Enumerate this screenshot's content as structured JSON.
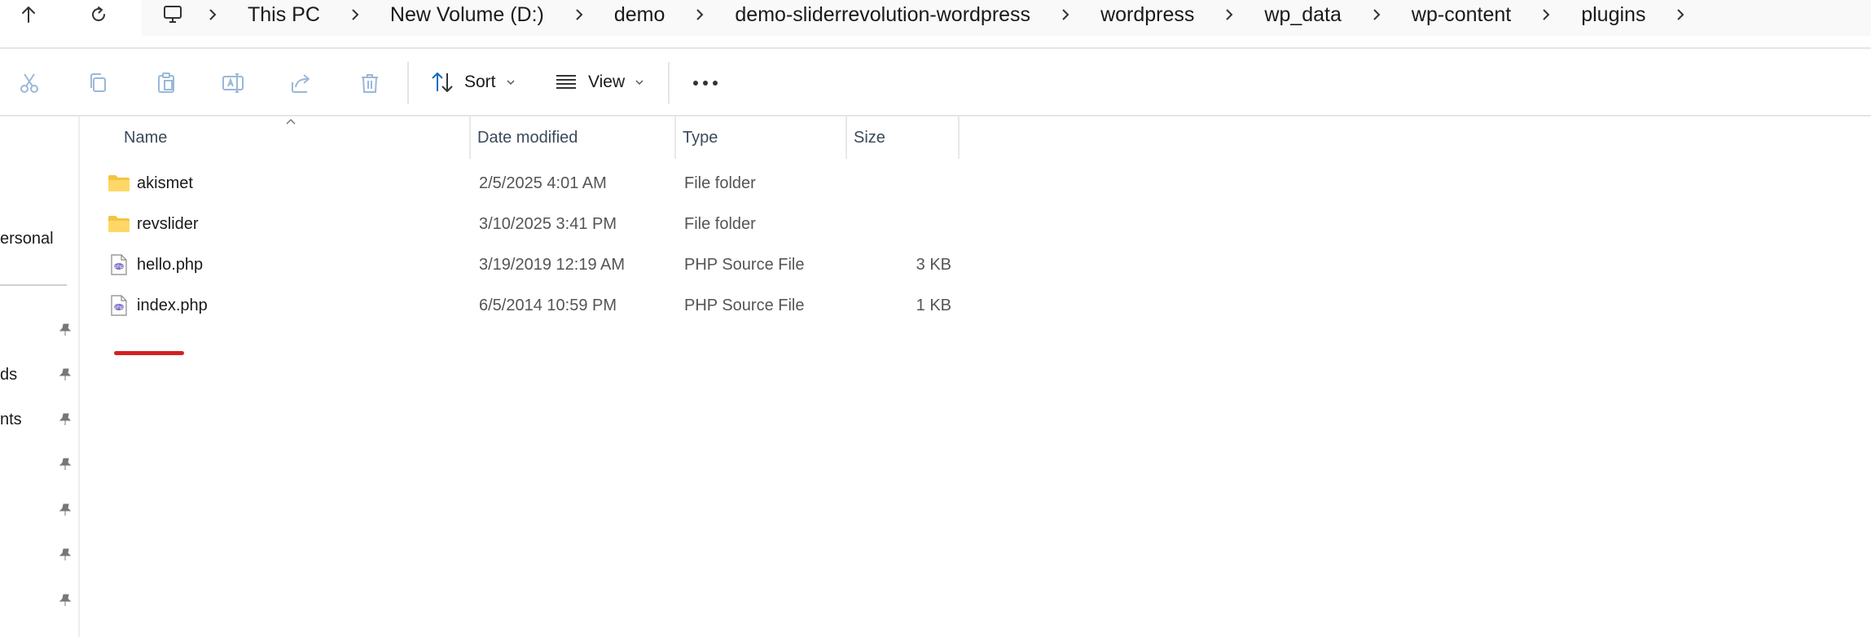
{
  "address_bar": {
    "crumbs": [
      "This PC",
      "New Volume (D:)",
      "demo",
      "demo-sliderrevolution-wordpress",
      "wordpress",
      "wp_data",
      "wp-content",
      "plugins"
    ]
  },
  "command_bar": {
    "sort_label": "Sort",
    "view_label": "View"
  },
  "nav_pane": {
    "items": [
      "ersonal",
      "ds",
      "nts"
    ]
  },
  "file_list": {
    "columns": {
      "name": "Name",
      "date": "Date modified",
      "type": "Type",
      "size": "Size"
    },
    "rows": [
      {
        "name": "akismet",
        "date": "2/5/2025 4:01 AM",
        "type": "File folder",
        "size": "",
        "icon": "folder-icon"
      },
      {
        "name": "revslider",
        "date": "3/10/2025 3:41 PM",
        "type": "File folder",
        "size": "",
        "icon": "folder-icon"
      },
      {
        "name": "hello.php",
        "date": "3/19/2019 12:19 AM",
        "type": "PHP Source File",
        "size": "3 KB",
        "icon": "php-file-icon"
      },
      {
        "name": "index.php",
        "date": "6/5/2014 10:59 PM",
        "type": "PHP Source File",
        "size": "1 KB",
        "icon": "php-file-icon"
      }
    ]
  },
  "colors": {
    "folder": "#f5c342",
    "accent": "#0f6cbd",
    "annotation": "#d42020",
    "php_icon": "#6a5acd"
  }
}
